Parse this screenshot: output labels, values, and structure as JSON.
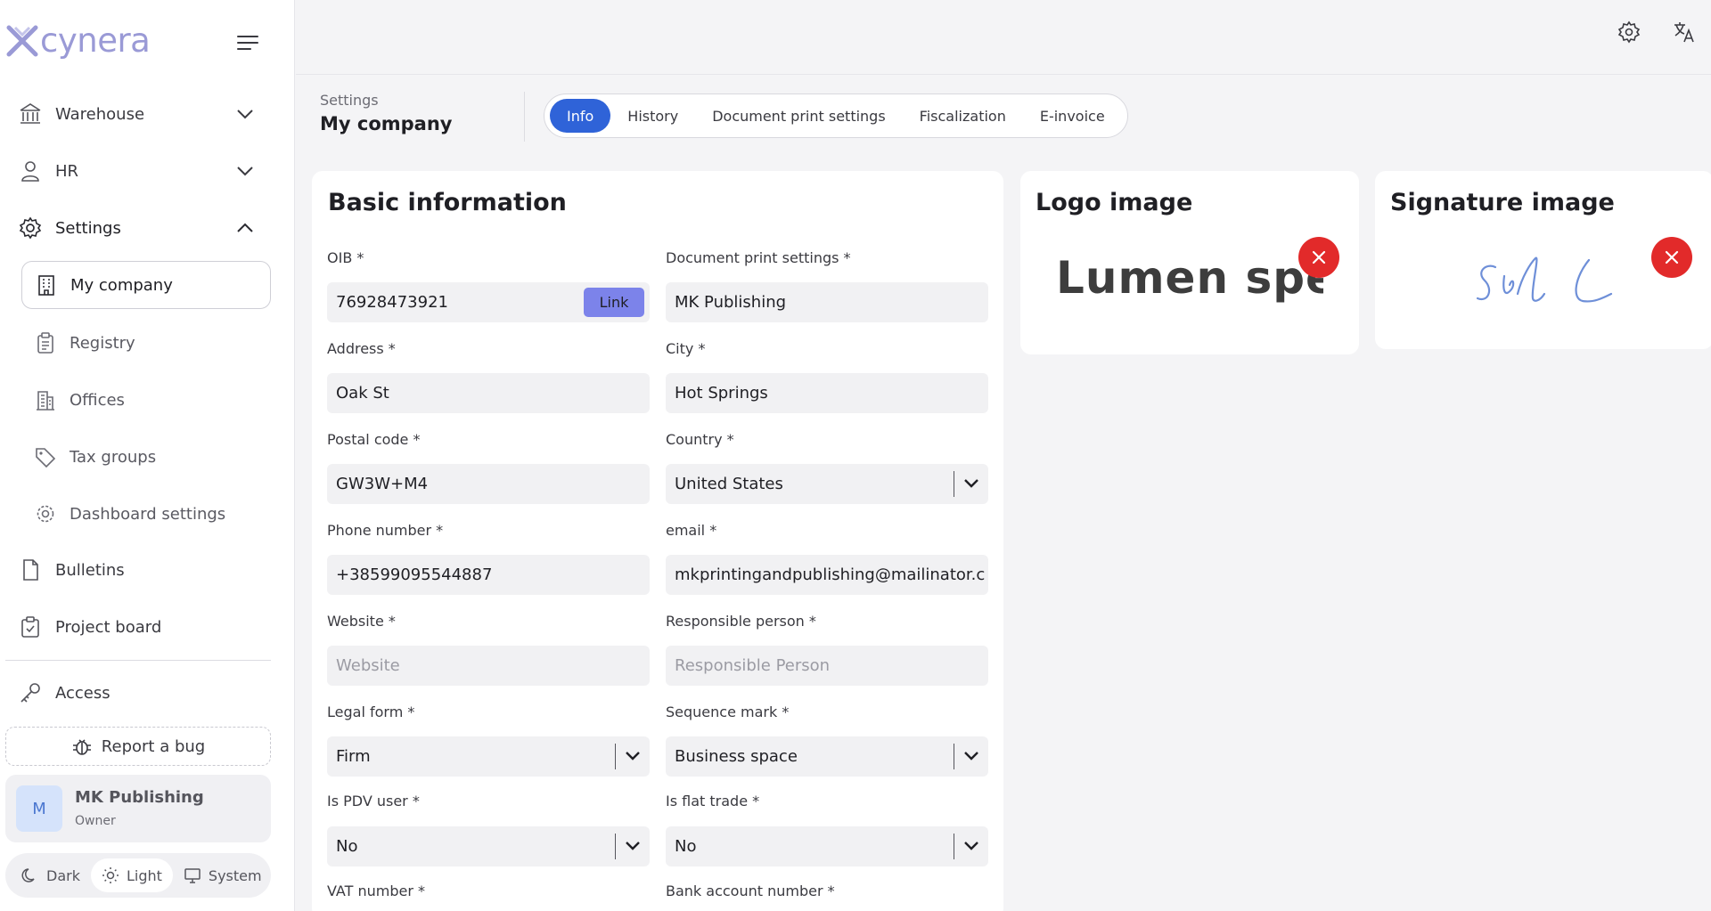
{
  "app": {
    "brand": "cynera",
    "accent": "#2f63d8",
    "brand_color": "#9a9ad6",
    "remove_color": "#e22a2a"
  },
  "sidebar": {
    "nav": [
      {
        "label": "Warehouse",
        "icon": "warehouse-icon",
        "expanded": false
      },
      {
        "label": "HR",
        "icon": "person-icon",
        "expanded": false
      },
      {
        "label": "Settings",
        "icon": "gear-icon",
        "expanded": true
      }
    ],
    "settings_items": [
      {
        "label": "My company",
        "icon": "building-icon",
        "active": true
      },
      {
        "label": "Registry",
        "icon": "clipboard-icon"
      },
      {
        "label": "Offices",
        "icon": "office-icon"
      },
      {
        "label": "Tax groups",
        "icon": "tag-icon"
      },
      {
        "label": "Dashboard settings",
        "icon": "cog-icon"
      }
    ],
    "more": [
      {
        "label": "Bulletins",
        "icon": "document-icon"
      },
      {
        "label": "Project board",
        "icon": "board-icon"
      }
    ],
    "access": {
      "label": "Access",
      "icon": "key-icon"
    },
    "report_bug": "Report a bug",
    "user": {
      "initial": "M",
      "name": "MK Publishing",
      "role": "Owner"
    },
    "theme": {
      "options": [
        "Dark",
        "Light",
        "System"
      ],
      "selected": "Light"
    }
  },
  "header": {
    "breadcrumb": "Settings",
    "title": "My company",
    "tabs": [
      "Info",
      "History",
      "Document print settings",
      "Fiscalization",
      "E-invoice"
    ],
    "active_tab": "Info"
  },
  "basic_info": {
    "title": "Basic information",
    "link_label": "Link",
    "fields": [
      {
        "label": "OIB *",
        "value": "76928473921"
      },
      {
        "label": "Document print settings *",
        "value": "MK Publishing"
      },
      {
        "label": "Address *",
        "value": "Oak St"
      },
      {
        "label": "City *",
        "value": "Hot Springs"
      },
      {
        "label": "Postal code *",
        "value": "GW3W+M4"
      },
      {
        "label": "Country *",
        "value": "United States"
      },
      {
        "label": "Phone number *",
        "value": "+38599095544887"
      },
      {
        "label": "email *",
        "value": "mkprintingandpublishing@mailinator.c"
      },
      {
        "label": "Website *",
        "placeholder": "Website"
      },
      {
        "label": "Responsible person *",
        "placeholder": "Responsible Person"
      },
      {
        "label": "Legal form *",
        "value": "Firm"
      },
      {
        "label": "Sequence mark *",
        "value": "Business space"
      },
      {
        "label": "Is PDV user *",
        "value": "No"
      },
      {
        "label": "Is flat trade *",
        "value": "No"
      },
      {
        "label": "VAT number *"
      },
      {
        "label": "Bank account number *"
      }
    ]
  },
  "logo_panel": {
    "title": "Logo image",
    "logo_text": "Lumen spel"
  },
  "signature_panel": {
    "title": "Signature image"
  }
}
